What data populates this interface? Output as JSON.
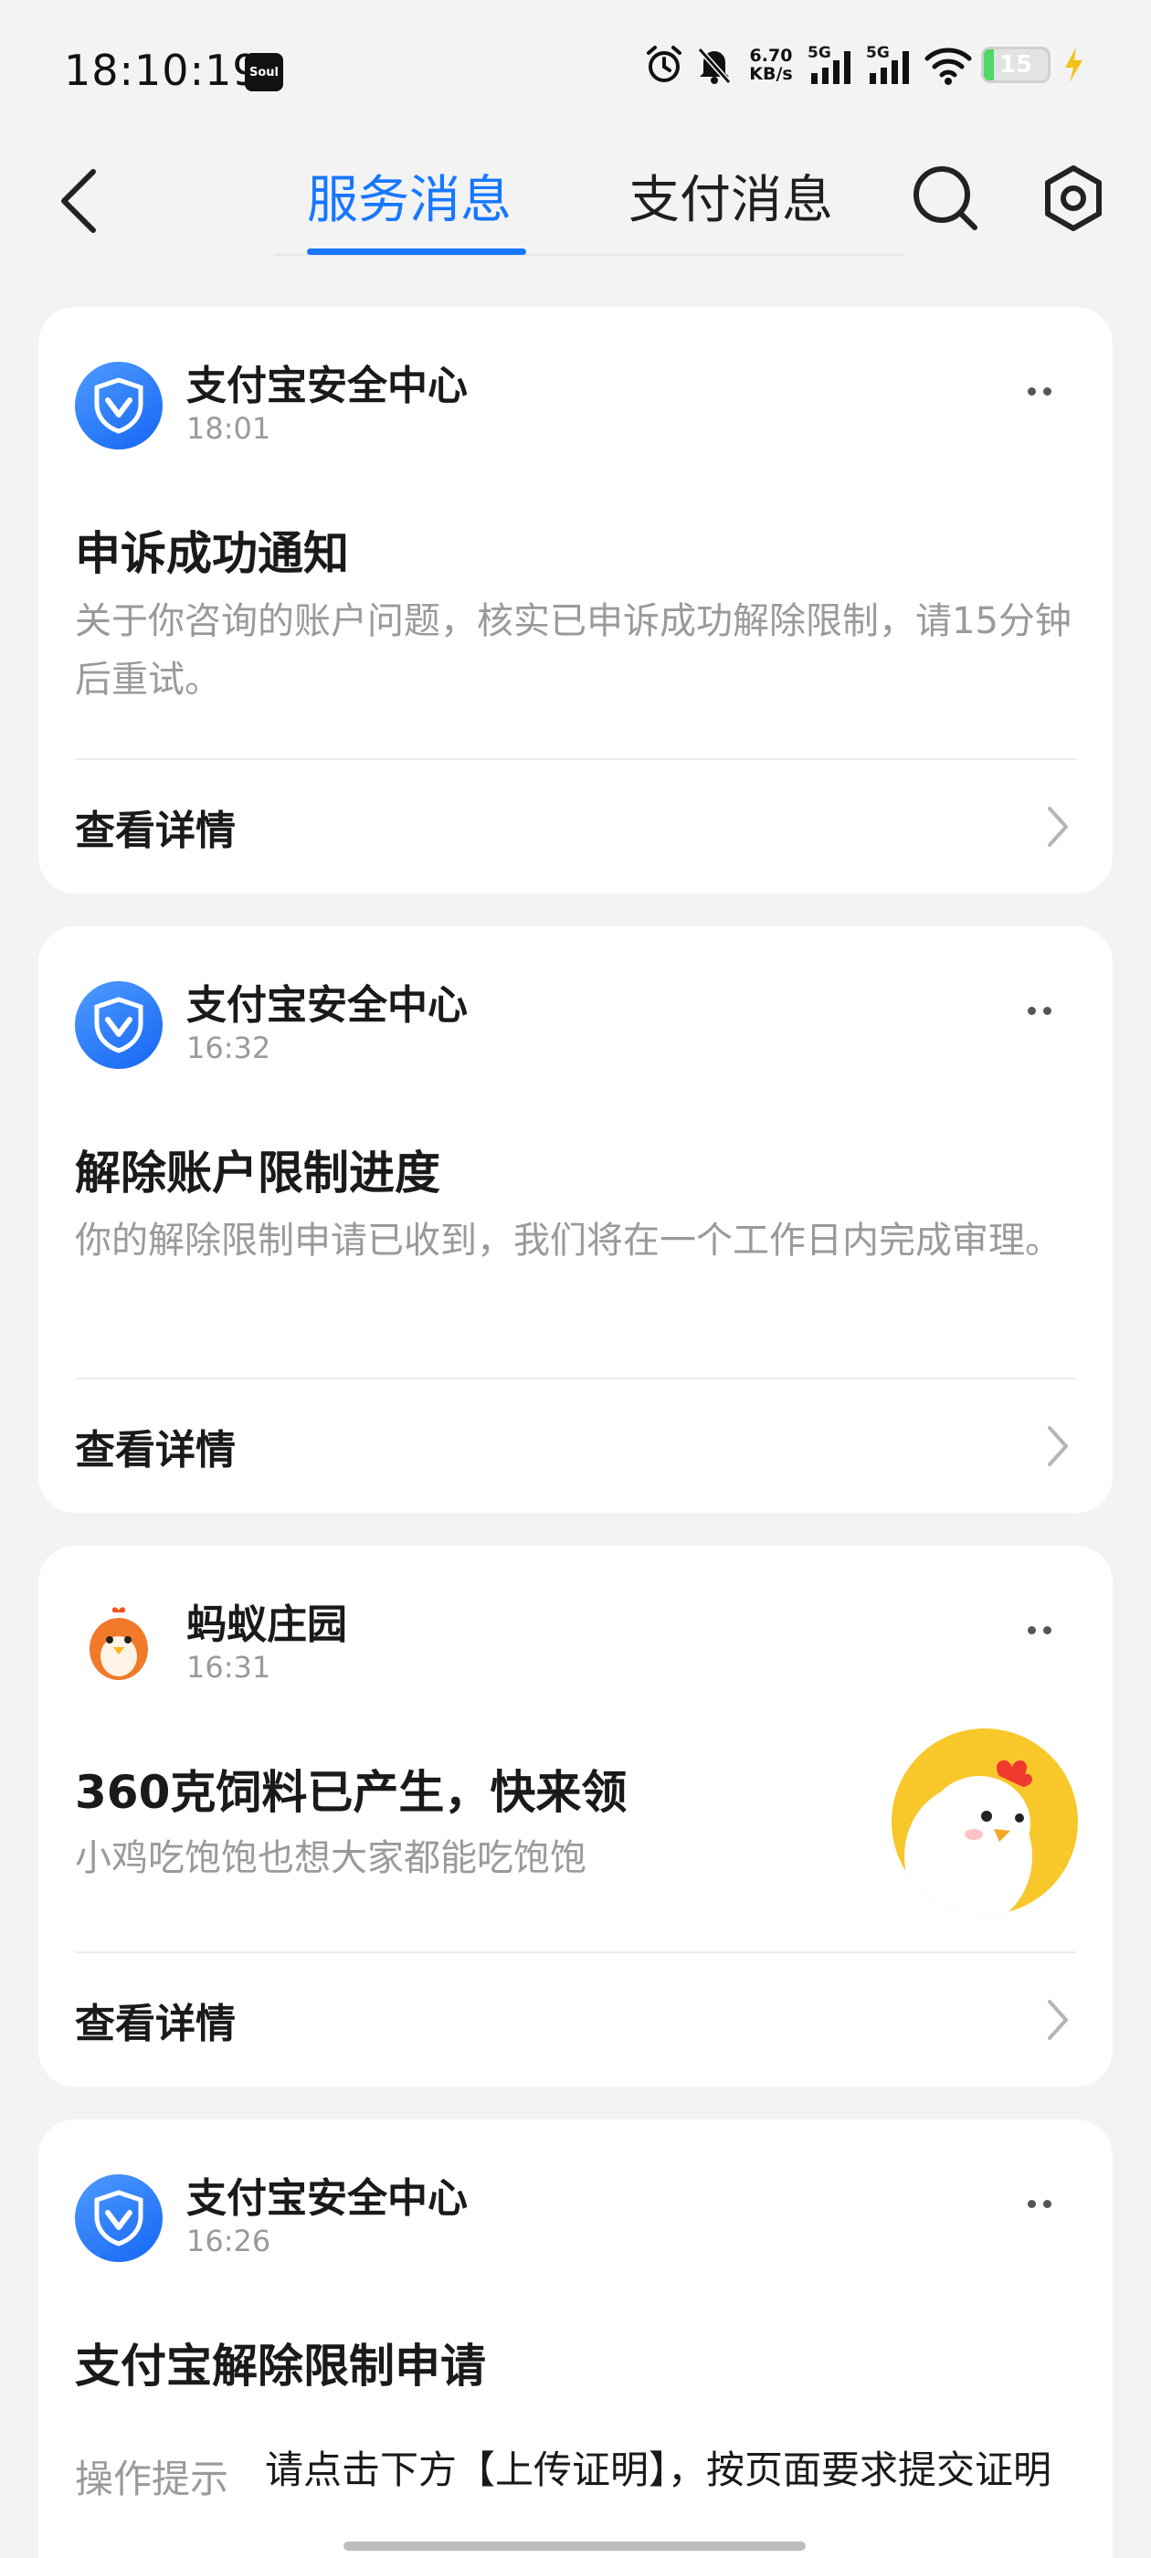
{
  "status_bar": {
    "time": "18:10:19",
    "app_badge": "Soul",
    "net_speed_value": "6.70",
    "net_speed_unit": "KB/s",
    "signal_1_label": "5G",
    "signal_2_label": "5G",
    "battery_level": "15",
    "battery_fraction": 0.15
  },
  "header": {
    "tabs": [
      {
        "label": "服务消息",
        "active": true
      },
      {
        "label": "支付消息",
        "active": false
      }
    ]
  },
  "messages": [
    {
      "sender": "支付宝安全中心",
      "time": "18:01",
      "title": "申诉成功通知",
      "body": "关于你咨询的账户问题，核实已申诉成功解除限制，请15分钟后重试。",
      "action": "查看详情"
    },
    {
      "sender": "支付宝安全中心",
      "time": "16:32",
      "title": "解除账户限制进度",
      "body": "你的解除限制申请已收到，我们将在一个工作日内完成审理。",
      "action": "查看详情"
    },
    {
      "sender": "蚂蚁庄园",
      "time": "16:31",
      "title": "360克饲料已产生，快来领",
      "body": "小鸡吃饱饱也想大家都能吃饱饱",
      "action": "查看详情"
    },
    {
      "sender": "支付宝安全中心",
      "time": "16:26",
      "title": "支付宝解除限制申请",
      "op_label": "操作提示",
      "op_text": "请点击下方【上传证明】，按页面要求提交证明"
    }
  ],
  "colors": {
    "accent": "#1677ff",
    "background": "#f3f3f3",
    "card": "#ffffff",
    "muted_text": "#9a9a9a",
    "chick_bg": "#f8c82a"
  },
  "icons": {
    "back": "chevron-left-icon",
    "search": "search-icon",
    "settings": "gear-icon",
    "more": "more-dots-icon",
    "detail": "chevron-right-icon",
    "alipay_security_logo": "shield-check-icon",
    "ant_farm_logo": "chick-icon"
  }
}
